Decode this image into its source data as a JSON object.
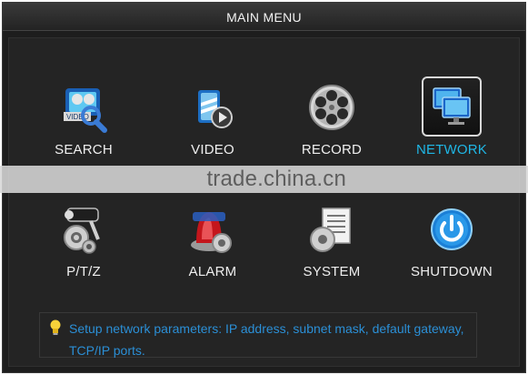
{
  "window": {
    "title": "MAIN MENU"
  },
  "menu": {
    "items": [
      {
        "id": "search",
        "label": "SEARCH",
        "icon": "search-video-icon",
        "selected": false
      },
      {
        "id": "video",
        "label": "VIDEO",
        "icon": "video-icon",
        "selected": false
      },
      {
        "id": "record",
        "label": "RECORD",
        "icon": "film-reel-icon",
        "selected": false
      },
      {
        "id": "network",
        "label": "NETWORK",
        "icon": "network-monitor-icon",
        "selected": true
      },
      {
        "id": "ptz",
        "label": "P/T/Z",
        "icon": "ptz-camera-gear-icon",
        "selected": false
      },
      {
        "id": "alarm",
        "label": "ALARM",
        "icon": "alarm-siren-gear-icon",
        "selected": false
      },
      {
        "id": "system",
        "label": "SYSTEM",
        "icon": "system-document-gear-icon",
        "selected": false
      },
      {
        "id": "shutdown",
        "label": "SHUTDOWN",
        "icon": "power-icon",
        "selected": false
      }
    ]
  },
  "hint": {
    "icon": "lightbulb-icon",
    "text": "Setup network parameters: IP address, subnet mask, default gateway, TCP/IP ports."
  },
  "watermark": {
    "text": "trade.china.cn"
  },
  "colors": {
    "background": "#1d1d1d",
    "selected_label": "#1fb7e6",
    "hint_text": "#2b8fd6",
    "label": "#efefef"
  }
}
